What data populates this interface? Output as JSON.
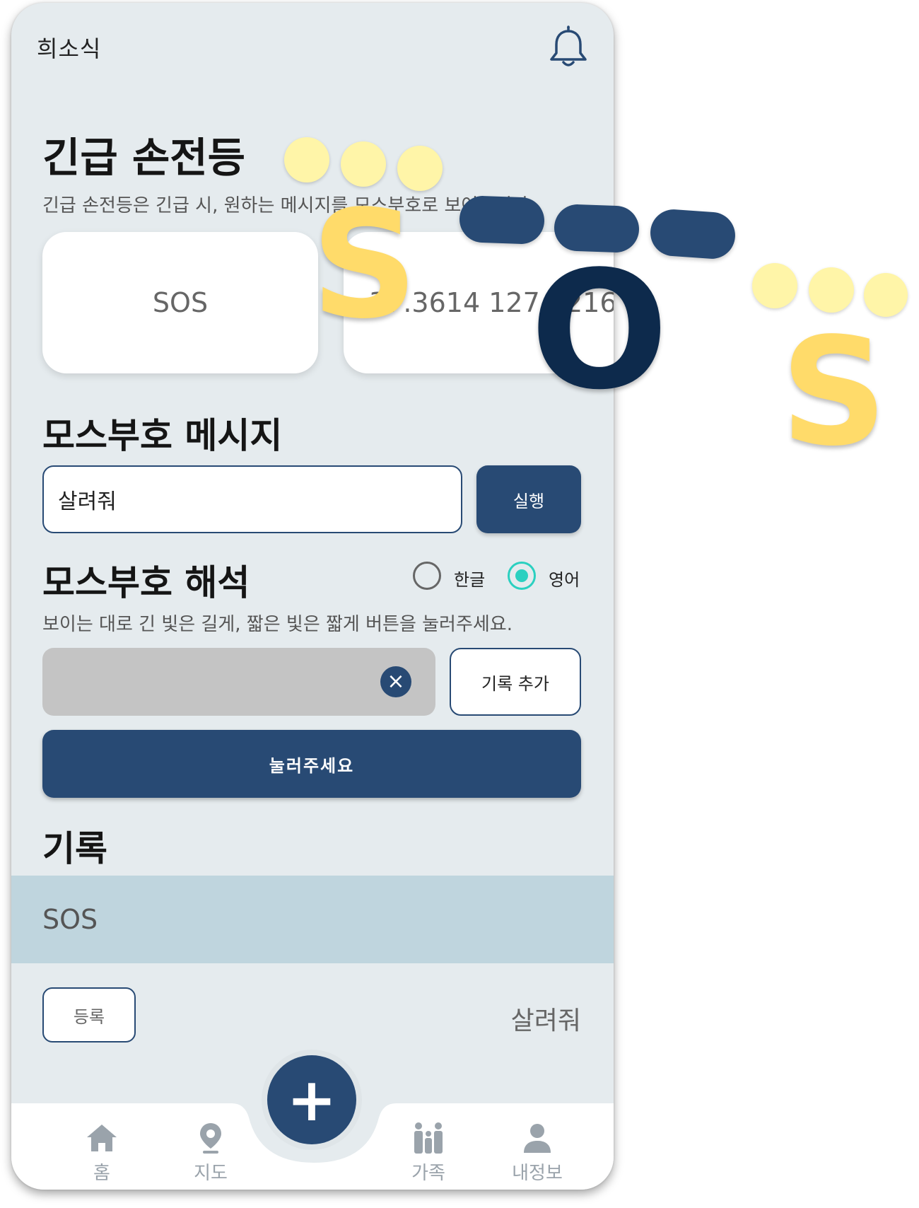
{
  "header": {
    "user_name": "희소식"
  },
  "flashlight": {
    "title": "긴급 손전등",
    "description": "긴급 손전등은 긴급 시, 원하는 메시지를 모스부호로 보여줍니다.",
    "card_sos": "SOS",
    "card_coords": "37.3614 127.3216"
  },
  "morse_message": {
    "title": "모스부호 메시지",
    "input_value": "살려줘",
    "run_button": "실행"
  },
  "morse_decode": {
    "title": "모스부호 해석",
    "options": [
      "한글",
      "영어"
    ],
    "selected": "영어",
    "description": "보이는 대로 긴 빛은 길게, 짧은 빛은 짧게 버튼을 눌러주세요.",
    "clear_symbol": "×",
    "add_record_button": "기록 추가",
    "press_button": "눌러주세요"
  },
  "records": {
    "title": "기록",
    "items": [
      {
        "code": "SOS",
        "register_button": "등록",
        "message": "살려줘"
      }
    ]
  },
  "nav": {
    "items": [
      "홈",
      "지도",
      "가족",
      "내정보"
    ],
    "fab_symbol": "+"
  },
  "overlay": {
    "letters": [
      "S",
      "O",
      "S"
    ],
    "colors": {
      "dot": "#fff5a8",
      "dash": "#284a74",
      "s": "#ffdb6a",
      "o": "#0d2a4c"
    }
  },
  "colors": {
    "primary": "#284a74",
    "background": "#e5ebee",
    "accent": "#2bd0c0",
    "record_row": "#bfd5de"
  }
}
